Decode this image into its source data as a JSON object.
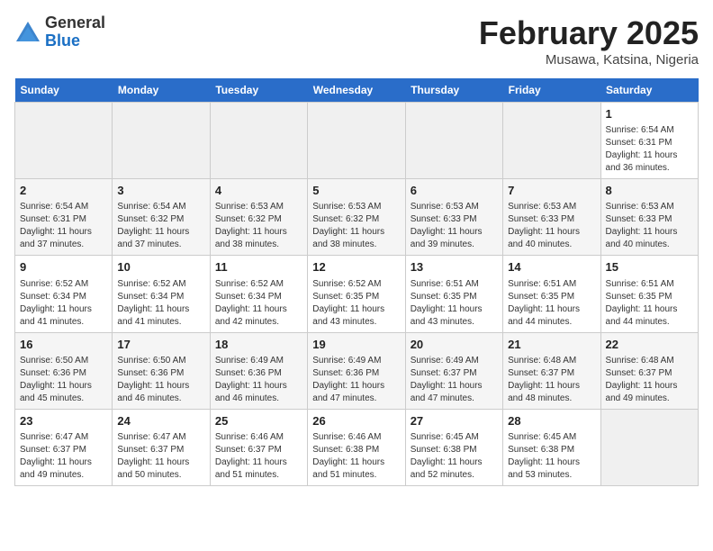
{
  "header": {
    "logo_general": "General",
    "logo_blue": "Blue",
    "title": "February 2025",
    "subtitle": "Musawa, Katsina, Nigeria"
  },
  "days_of_week": [
    "Sunday",
    "Monday",
    "Tuesday",
    "Wednesday",
    "Thursday",
    "Friday",
    "Saturday"
  ],
  "weeks": [
    [
      {
        "day": "",
        "info": ""
      },
      {
        "day": "",
        "info": ""
      },
      {
        "day": "",
        "info": ""
      },
      {
        "day": "",
        "info": ""
      },
      {
        "day": "",
        "info": ""
      },
      {
        "day": "",
        "info": ""
      },
      {
        "day": "1",
        "info": "Sunrise: 6:54 AM\nSunset: 6:31 PM\nDaylight: 11 hours\nand 36 minutes."
      }
    ],
    [
      {
        "day": "2",
        "info": "Sunrise: 6:54 AM\nSunset: 6:31 PM\nDaylight: 11 hours\nand 37 minutes."
      },
      {
        "day": "3",
        "info": "Sunrise: 6:54 AM\nSunset: 6:32 PM\nDaylight: 11 hours\nand 37 minutes."
      },
      {
        "day": "4",
        "info": "Sunrise: 6:53 AM\nSunset: 6:32 PM\nDaylight: 11 hours\nand 38 minutes."
      },
      {
        "day": "5",
        "info": "Sunrise: 6:53 AM\nSunset: 6:32 PM\nDaylight: 11 hours\nand 38 minutes."
      },
      {
        "day": "6",
        "info": "Sunrise: 6:53 AM\nSunset: 6:33 PM\nDaylight: 11 hours\nand 39 minutes."
      },
      {
        "day": "7",
        "info": "Sunrise: 6:53 AM\nSunset: 6:33 PM\nDaylight: 11 hours\nand 40 minutes."
      },
      {
        "day": "8",
        "info": "Sunrise: 6:53 AM\nSunset: 6:33 PM\nDaylight: 11 hours\nand 40 minutes."
      }
    ],
    [
      {
        "day": "9",
        "info": "Sunrise: 6:52 AM\nSunset: 6:34 PM\nDaylight: 11 hours\nand 41 minutes."
      },
      {
        "day": "10",
        "info": "Sunrise: 6:52 AM\nSunset: 6:34 PM\nDaylight: 11 hours\nand 41 minutes."
      },
      {
        "day": "11",
        "info": "Sunrise: 6:52 AM\nSunset: 6:34 PM\nDaylight: 11 hours\nand 42 minutes."
      },
      {
        "day": "12",
        "info": "Sunrise: 6:52 AM\nSunset: 6:35 PM\nDaylight: 11 hours\nand 43 minutes."
      },
      {
        "day": "13",
        "info": "Sunrise: 6:51 AM\nSunset: 6:35 PM\nDaylight: 11 hours\nand 43 minutes."
      },
      {
        "day": "14",
        "info": "Sunrise: 6:51 AM\nSunset: 6:35 PM\nDaylight: 11 hours\nand 44 minutes."
      },
      {
        "day": "15",
        "info": "Sunrise: 6:51 AM\nSunset: 6:35 PM\nDaylight: 11 hours\nand 44 minutes."
      }
    ],
    [
      {
        "day": "16",
        "info": "Sunrise: 6:50 AM\nSunset: 6:36 PM\nDaylight: 11 hours\nand 45 minutes."
      },
      {
        "day": "17",
        "info": "Sunrise: 6:50 AM\nSunset: 6:36 PM\nDaylight: 11 hours\nand 46 minutes."
      },
      {
        "day": "18",
        "info": "Sunrise: 6:49 AM\nSunset: 6:36 PM\nDaylight: 11 hours\nand 46 minutes."
      },
      {
        "day": "19",
        "info": "Sunrise: 6:49 AM\nSunset: 6:36 PM\nDaylight: 11 hours\nand 47 minutes."
      },
      {
        "day": "20",
        "info": "Sunrise: 6:49 AM\nSunset: 6:37 PM\nDaylight: 11 hours\nand 47 minutes."
      },
      {
        "day": "21",
        "info": "Sunrise: 6:48 AM\nSunset: 6:37 PM\nDaylight: 11 hours\nand 48 minutes."
      },
      {
        "day": "22",
        "info": "Sunrise: 6:48 AM\nSunset: 6:37 PM\nDaylight: 11 hours\nand 49 minutes."
      }
    ],
    [
      {
        "day": "23",
        "info": "Sunrise: 6:47 AM\nSunset: 6:37 PM\nDaylight: 11 hours\nand 49 minutes."
      },
      {
        "day": "24",
        "info": "Sunrise: 6:47 AM\nSunset: 6:37 PM\nDaylight: 11 hours\nand 50 minutes."
      },
      {
        "day": "25",
        "info": "Sunrise: 6:46 AM\nSunset: 6:37 PM\nDaylight: 11 hours\nand 51 minutes."
      },
      {
        "day": "26",
        "info": "Sunrise: 6:46 AM\nSunset: 6:38 PM\nDaylight: 11 hours\nand 51 minutes."
      },
      {
        "day": "27",
        "info": "Sunrise: 6:45 AM\nSunset: 6:38 PM\nDaylight: 11 hours\nand 52 minutes."
      },
      {
        "day": "28",
        "info": "Sunrise: 6:45 AM\nSunset: 6:38 PM\nDaylight: 11 hours\nand 53 minutes."
      },
      {
        "day": "",
        "info": ""
      }
    ]
  ]
}
